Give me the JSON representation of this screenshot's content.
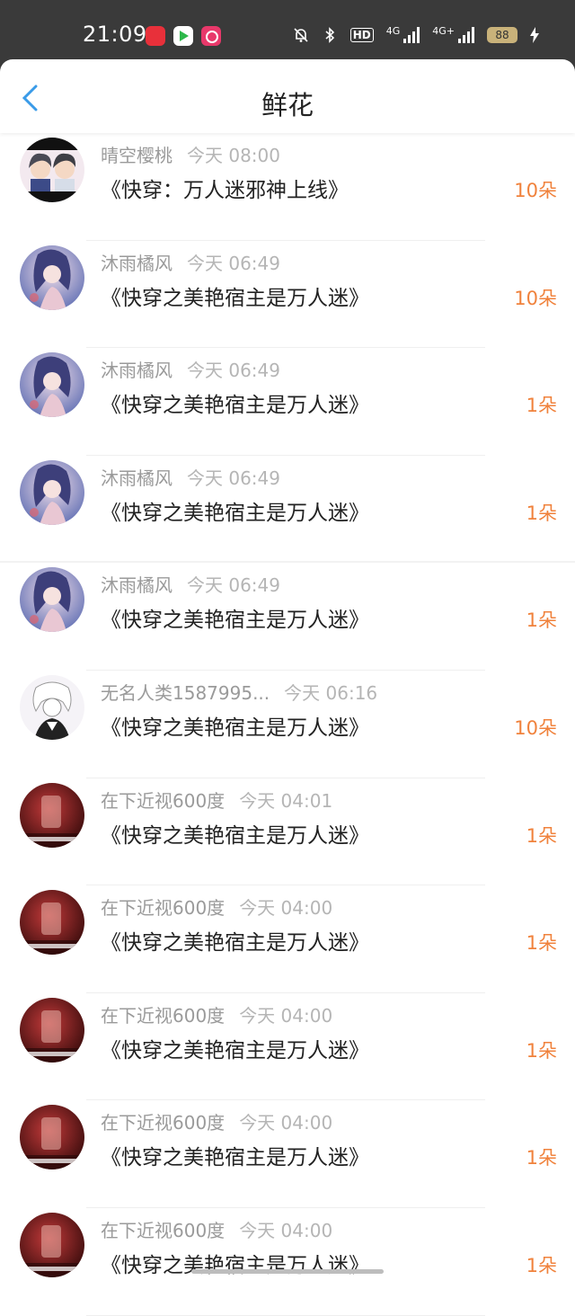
{
  "status_bar": {
    "time": "21:09",
    "battery": "88",
    "network_a": "4G",
    "network_b": "4G+",
    "hd": "HD"
  },
  "header": {
    "title": "鲜花"
  },
  "items": [
    {
      "user": "晴空樱桃",
      "time": "今天 08:00",
      "book": "《快穿：万人迷邪神上线》",
      "count": "10朵",
      "avatar": "cartoon"
    },
    {
      "user": "沐雨橘风",
      "time": "今天 06:49",
      "book": "《快穿之美艳宿主是万人迷》",
      "count": "10朵",
      "avatar": "anime"
    },
    {
      "user": "沐雨橘风",
      "time": "今天 06:49",
      "book": "《快穿之美艳宿主是万人迷》",
      "count": "1朵",
      "avatar": "anime"
    },
    {
      "user": "沐雨橘风",
      "time": "今天 06:49",
      "book": "《快穿之美艳宿主是万人迷》",
      "count": "1朵",
      "avatar": "anime"
    },
    {
      "user": "沐雨橘风",
      "time": "今天 06:49",
      "book": "《快穿之美艳宿主是万人迷》",
      "count": "1朵",
      "avatar": "anime"
    },
    {
      "user": "无名人类1587995...",
      "time": "今天 06:16",
      "book": "《快穿之美艳宿主是万人迷》",
      "count": "10朵",
      "avatar": "sketch"
    },
    {
      "user": "在下近视600度",
      "time": "今天 04:01",
      "book": "《快穿之美艳宿主是万人迷》",
      "count": "1朵",
      "avatar": "red"
    },
    {
      "user": "在下近视600度",
      "time": "今天 04:00",
      "book": "《快穿之美艳宿主是万人迷》",
      "count": "1朵",
      "avatar": "red"
    },
    {
      "user": "在下近视600度",
      "time": "今天 04:00",
      "book": "《快穿之美艳宿主是万人迷》",
      "count": "1朵",
      "avatar": "red"
    },
    {
      "user": "在下近视600度",
      "time": "今天 04:00",
      "book": "《快穿之美艳宿主是万人迷》",
      "count": "1朵",
      "avatar": "red"
    },
    {
      "user": "在下近视600度",
      "time": "今天 04:00",
      "book": "《快穿之美艳宿主是万人迷》",
      "count": "1朵",
      "avatar": "red"
    }
  ]
}
